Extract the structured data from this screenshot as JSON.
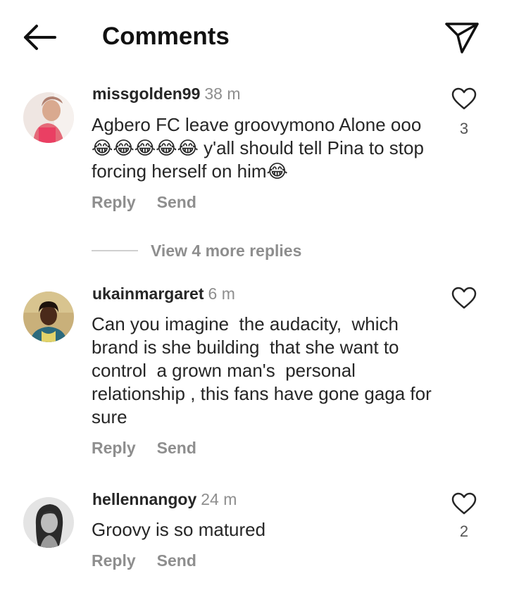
{
  "header": {
    "title": "Comments",
    "back_icon": "arrow-left-icon",
    "share_icon": "paper-plane-icon"
  },
  "comments": [
    {
      "username": "missgolden99",
      "time": "38 m",
      "text": "Agbero FC leave groovymono Alone ooo😂😂😂😂😂 y'all should tell Pina to stop forcing herself on him😂",
      "reply_label": "Reply",
      "send_label": "Send",
      "likes": "3",
      "like_icon": "heart-outline-icon"
    },
    {
      "username": "ukainmargaret",
      "time": "6 m",
      "text": "Can you imagine  the audacity,  which brand is she building  that she want to control  a grown man's  personal relationship , this fans have gone gaga for sure",
      "reply_label": "Reply",
      "send_label": "Send",
      "likes": "",
      "like_icon": "heart-outline-icon"
    },
    {
      "username": "hellennangoy",
      "time": "24 m",
      "text": "Groovy is so matured",
      "reply_label": "Reply",
      "send_label": "Send",
      "likes": "2",
      "like_icon": "heart-outline-icon"
    }
  ],
  "view_replies": "View 4 more replies",
  "colors": {
    "text": "#262626",
    "muted": "#8e8e8e",
    "background": "#ffffff"
  }
}
